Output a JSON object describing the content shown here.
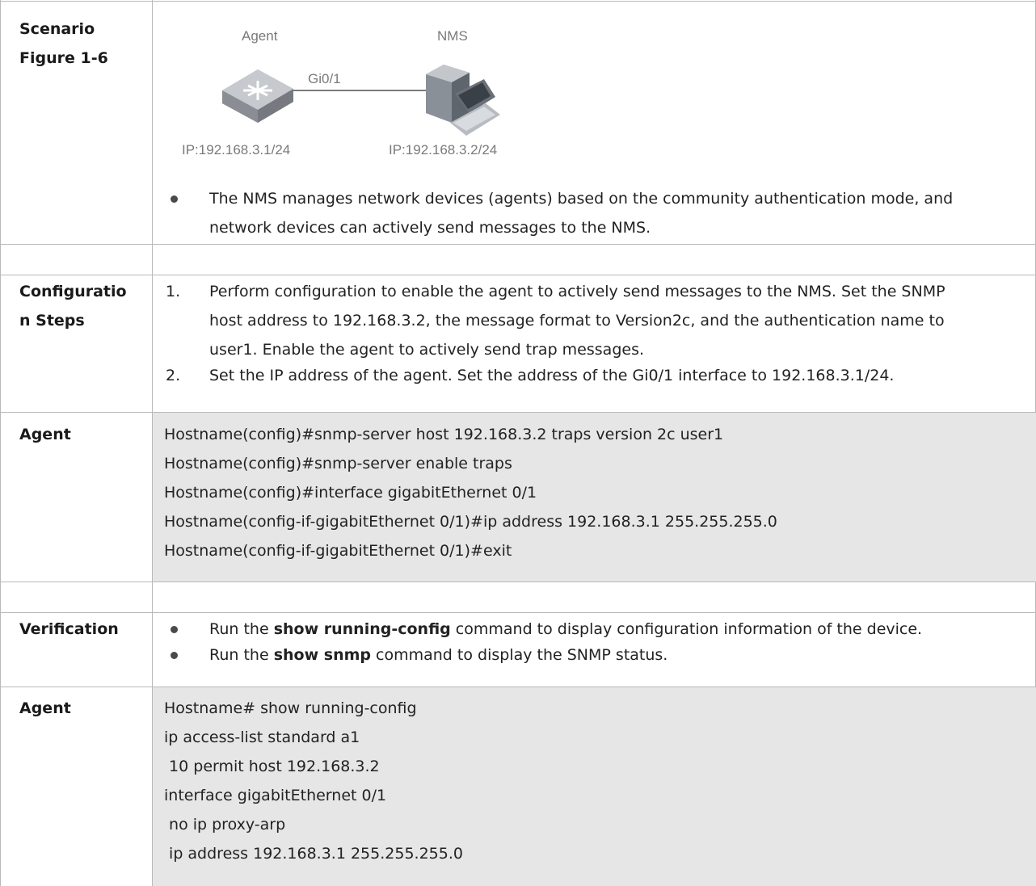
{
  "scenario": {
    "label_line1": "Scenario",
    "label_line2": "Figure 1-6",
    "diagram": {
      "agent_label": "Agent",
      "nms_label": "NMS",
      "port_label": "Gi0/1",
      "agent_ip": "IP:192.168.3.1/24",
      "nms_ip": "IP:192.168.3.2/24"
    },
    "bullet_line1": "The NMS manages network devices (agents) based on the community authentication mode, and",
    "bullet_line2": "network devices can actively send messages to the NMS."
  },
  "config_steps": {
    "label_line1": "Configuratio",
    "label_line2": "n Steps",
    "step1_num": "1.",
    "step1_line1": "Perform configuration to enable the agent to actively send messages to the NMS. Set the SNMP",
    "step1_line2": "host address to 192.168.3.2, the message format to Version2c, and the authentication name to",
    "step1_line3": "user1. Enable the agent to actively send trap messages.",
    "step2_num": "2.",
    "step2_text": "Set the IP address of the agent. Set the address of the Gi0/1 interface to 192.168.3.1/24."
  },
  "agent_config": {
    "label": "Agent",
    "lines": [
      "Hostname(config)#snmp-server host 192.168.3.2 traps version 2c user1",
      "Hostname(config)#snmp-server enable traps",
      "Hostname(config)#interface gigabitEthernet 0/1",
      "Hostname(config-if-gigabitEthernet 0/1)#ip address 192.168.3.1 255.255.255.0",
      "Hostname(config-if-gigabitEthernet 0/1)#exit"
    ]
  },
  "verification": {
    "label": "Verification",
    "b1_pre": "Run the ",
    "b1_cmd": "show running-config",
    "b1_post": " command to display configuration information of the device.",
    "b2_pre": "Run the ",
    "b2_cmd": "show snmp",
    "b2_post": " command to display the SNMP status."
  },
  "agent_output": {
    "label": "Agent",
    "lines": [
      "Hostname# show running-config",
      "ip access-list standard a1",
      " 10 permit host 192.168.3.2",
      "interface gigabitEthernet 0/1",
      " no ip proxy-arp",
      " ip address 192.168.3.1 255.255.255.0"
    ]
  }
}
